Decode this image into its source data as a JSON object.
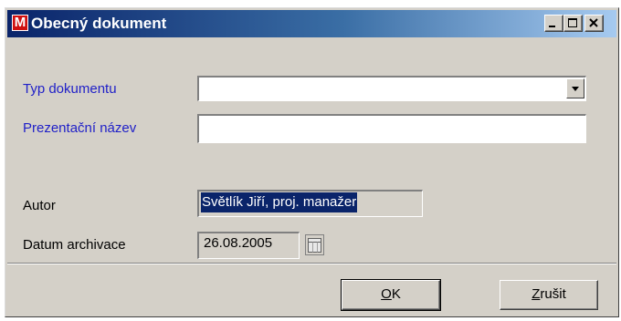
{
  "window": {
    "app_icon_letter": "M",
    "title": "Obecný dokument",
    "controls": {
      "minimize": "minimize-icon",
      "maximize": "maximize-icon",
      "close": "close-icon"
    }
  },
  "form": {
    "document_type": {
      "label": "Typ dokumentu",
      "value": ""
    },
    "display_name": {
      "label": "Prezentační název",
      "value": ""
    },
    "author": {
      "label": "Autor",
      "value": "Světlík Jiří, proj. manažer"
    },
    "archive_date": {
      "label": "Datum archivace",
      "value": "26.08.2005"
    }
  },
  "buttons": {
    "ok": {
      "mnemonic": "O",
      "rest": "K"
    },
    "cancel": {
      "mnemonic": "Z",
      "rest": "rušit"
    }
  },
  "colors": {
    "required_label": "#1f1fc8",
    "selection": "#0a246a"
  }
}
